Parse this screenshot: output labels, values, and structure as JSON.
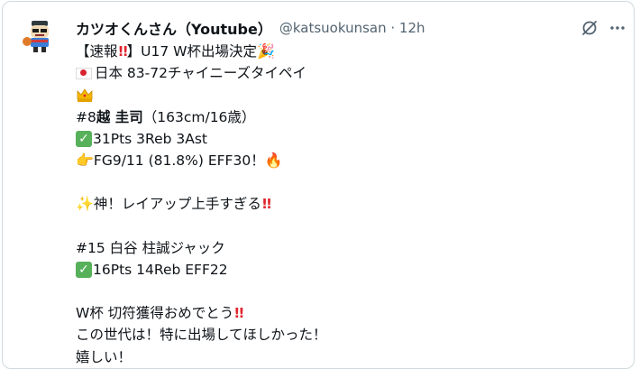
{
  "author": {
    "display_name": "カツオくんさん（Youtube）",
    "handle_time": "@katsuokunsan · 12h"
  },
  "icons": {
    "avatar": "avatar-image",
    "grok": "grok-slash-circle-icon",
    "more": "more-dots-icon",
    "party": "party-popper-icon",
    "crown": "crown-icon",
    "check": "check-mark-button-icon",
    "pointing": "pointing-right-hand-icon",
    "fire": "fire-icon",
    "sparkles": "sparkles-icon",
    "bang": "double-exclamation-icon",
    "flag": "japan-flag-icon"
  },
  "tweet": {
    "l1_a": "【速報",
    "l1_b": "】U17 W杯出場決定",
    "l2": "日本 83-72チャイニーズタイペイ",
    "l4_a": "#8 ",
    "l4_b": "越 圭司",
    "l4_c": "（163cm/16歳）",
    "l5": "31Pts 3Reb 3Ast",
    "l6": "FG9/11 (81.8%) EFF30！",
    "l8": "神！レイアップ上手すぎる",
    "l10": "#15 白谷 柱誠ジャック",
    "l11": "16Pts 14Reb EFF22",
    "l13": "W杯 切符獲得おめでとう",
    "l14": "この世代は！特に出場してほしかった！",
    "l15": "嬉しい！"
  },
  "colors": {
    "text": "#0f1419",
    "muted": "#536471",
    "border": "#cfd9de",
    "check": "#57b05a",
    "bang": "#e0242e"
  }
}
